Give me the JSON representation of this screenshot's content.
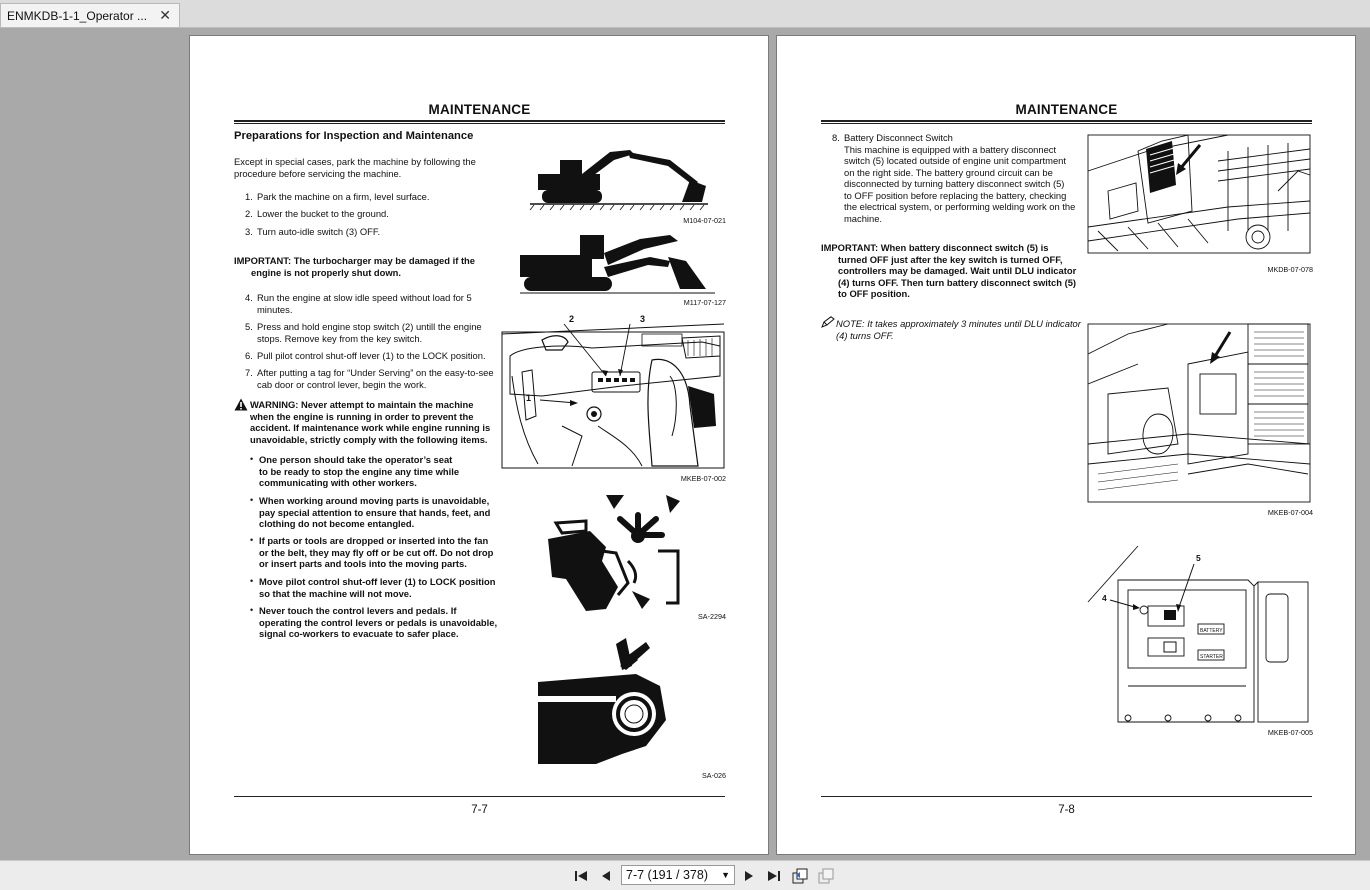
{
  "tab": {
    "title": "ENMKDB-1-1_Operator ..."
  },
  "left": {
    "header": "MAINTENANCE",
    "section_title": "Preparations for Inspection and Maintenance",
    "intro": [
      "Except in special cases, park the machine by following the",
      "procedure before servicing the machine."
    ],
    "steps_a": [
      {
        "n": "1.",
        "lines": [
          "Park the machine on a firm, level surface."
        ]
      },
      {
        "n": "2.",
        "lines": [
          "Lower the bucket to the ground."
        ]
      },
      {
        "n": "3.",
        "lines": [
          "Turn auto-idle switch (3) OFF."
        ]
      }
    ],
    "important": [
      "IMPORTANT:    The turbocharger may be damaged if the",
      "engine is not properly shut down."
    ],
    "steps_b": [
      {
        "n": "4.",
        "lines": [
          "Run the engine at slow idle speed without load for 5",
          "minutes."
        ]
      },
      {
        "n": "5.",
        "lines": [
          "Press and hold engine stop switch (2) untill the engine",
          "stops. Remove key from the key switch."
        ]
      },
      {
        "n": "6.",
        "lines": [
          "Pull pilot control shut-off lever (1) to the LOCK position."
        ]
      },
      {
        "n": "7.",
        "lines": [
          "After putting a tag for “Under Serving” on the easy-to-see",
          "cab door or control lever, begin the work."
        ]
      }
    ],
    "warning": [
      "WARNING:    Never attempt to maintain the machine",
      "when the engine is running in order to prevent the",
      "accident. If maintenance work while engine running is",
      "unavoidable, strictly comply with the following items."
    ],
    "bullets": [
      [
        "One person should take the operator’s seat",
        "to be ready to stop the engine any time while",
        "communicating with other workers."
      ],
      [
        "When working around moving parts is unavoidable,",
        "pay special attention to ensure that hands, feet, and",
        "clothing do not become entangled."
      ],
      [
        "If parts or tools are dropped or inserted into the fan",
        "or the belt, they may fly off or be cut off. Do not drop",
        "or insert parts and tools into the moving parts."
      ],
      [
        "Move pilot control shut-off lever (1) to LOCK position",
        "so that the machine will not move."
      ],
      [
        "Never touch the control levers and pedals. If",
        "operating the control levers or pedals is unavoidable,",
        "signal co-workers to evacuate to safer place."
      ]
    ],
    "captions": [
      "M104-07-021",
      "M117-07-127",
      "MKEB-07-002",
      "SA-2294",
      "SA-026"
    ],
    "callouts": [
      "2",
      "3",
      "1"
    ],
    "page_number": "7-7"
  },
  "right": {
    "header": "MAINTENANCE",
    "item_num": "8.",
    "item_title": "Battery Disconnect Switch",
    "item_body": [
      "This machine is equipped with a battery disconnect",
      "switch (5) located outside of engine unit compartment",
      "on the right side. The battery ground circuit can be",
      "disconnected by turning battery disconnect switch (5)",
      "to OFF position before replacing the battery, checking",
      "the electrical system, or performing welding work on the",
      "machine."
    ],
    "important": [
      "IMPORTANT:    When battery disconnect switch (5) is",
      "turned OFF just after the key switch is turned OFF,",
      "controllers may be damaged. Wait until DLU indicator",
      "(4) turns OFF. Then turn battery disconnect switch (5)",
      "to OFF position."
    ],
    "note": [
      "NOTE:    It takes approximately 3 minutes until DLU indicator",
      "(4) turns OFF."
    ],
    "captions": [
      "MKDB-07-078",
      "MKEB-07-004",
      "MKEB-07-005"
    ],
    "callouts": [
      "5",
      "4"
    ],
    "switch_labels": [
      "BATTERY",
      "STARTER"
    ],
    "page_number": "7-8"
  },
  "toolbar": {
    "page_display": "7-7 (191 / 378)"
  }
}
